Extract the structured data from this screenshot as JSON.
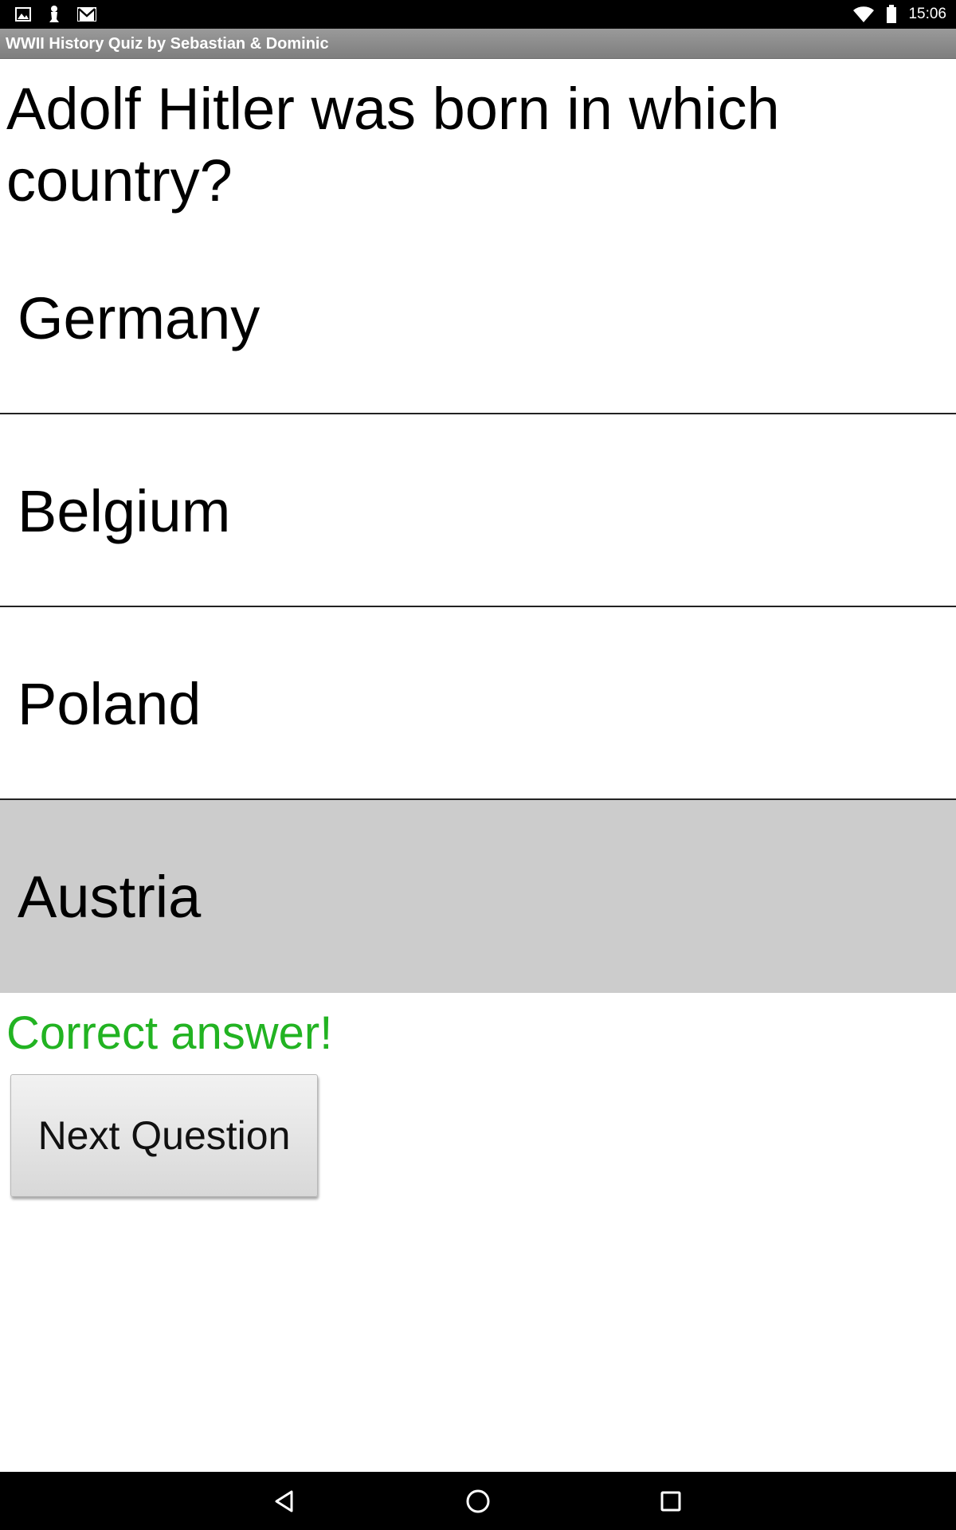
{
  "status_bar": {
    "time": "15:06",
    "left_icons": [
      "image-icon",
      "chess-piece-icon",
      "gmail-icon"
    ],
    "right_icons": [
      "wifi-icon",
      "battery-icon"
    ]
  },
  "app": {
    "title": "WWII History Quiz by Sebastian & Dominic"
  },
  "quiz": {
    "question": "Adolf Hitler was born in which country?",
    "answers": [
      {
        "label": "Germany",
        "selected": false
      },
      {
        "label": "Belgium",
        "selected": false
      },
      {
        "label": "Poland",
        "selected": false
      },
      {
        "label": "Austria",
        "selected": true
      }
    ],
    "feedback": "Correct answer!",
    "next_button_label": "Next Question"
  },
  "colors": {
    "feedback_correct": "#22b322",
    "selected_answer_bg": "#cccccc"
  },
  "nav_bar": {
    "buttons": [
      "back-icon",
      "home-icon",
      "recents-icon"
    ]
  }
}
